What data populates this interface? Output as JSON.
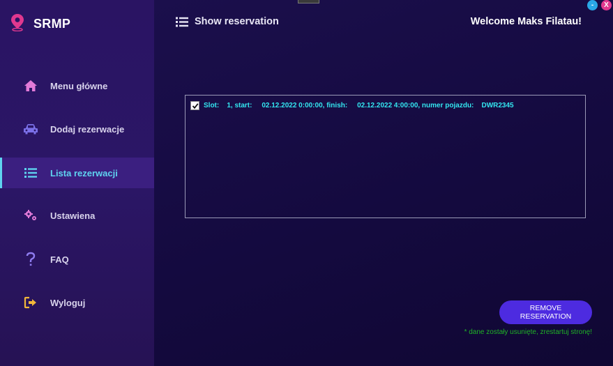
{
  "app": {
    "title": "SRMP"
  },
  "header": {
    "title": "Show reservation",
    "welcome": "Welcome Maks Filatau!"
  },
  "window_controls": {
    "minimize": "-",
    "close": "X"
  },
  "sidebar": {
    "items": [
      {
        "label": "Menu główne",
        "icon": "home-icon"
      },
      {
        "label": "Dodaj rezerwacje",
        "icon": "car-icon"
      },
      {
        "label": "Lista rezerwacji",
        "icon": "list-icon",
        "active": true
      },
      {
        "label": "Ustawiena",
        "icon": "gears-icon"
      },
      {
        "label": "FAQ",
        "icon": "question-icon"
      },
      {
        "label": "Wyloguj",
        "icon": "logout-icon"
      }
    ]
  },
  "reservations": [
    {
      "checked": true,
      "text": "Slot:    1, start:     02.12.2022 0:00:00, finish:     02.12.2022 4:00:00, numer pojazdu:    DWR2345"
    }
  ],
  "actions": {
    "remove_label": "REMOVE RESERVATION"
  },
  "notice": "* dane zostały usunięte, zrestartuj stronę!",
  "colors": {
    "accent": "#4d2be0",
    "active_text": "#5fd3f0",
    "list_text": "#33e6f0",
    "notice": "#1fb326",
    "logo_pin": "#e0388f"
  }
}
